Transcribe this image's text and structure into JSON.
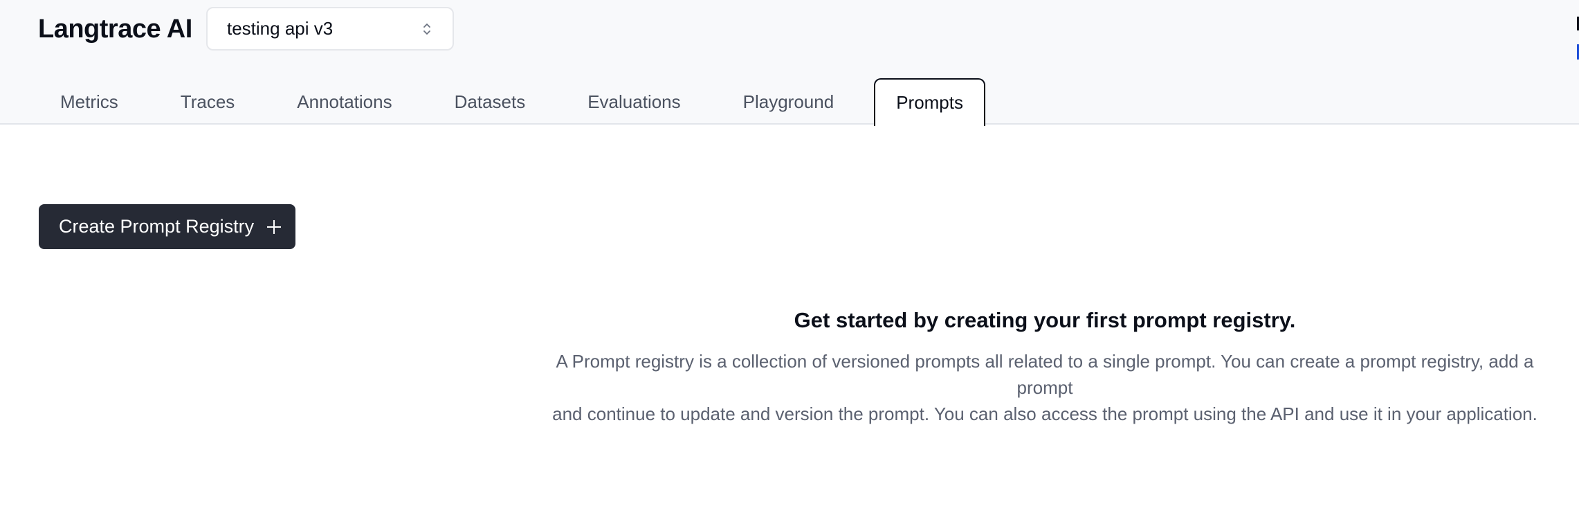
{
  "header": {
    "brand": "Langtrace AI",
    "project_select": {
      "value": "testing api v3",
      "icon": "chevron-up-down-icon"
    }
  },
  "tabs": [
    {
      "label": "Metrics",
      "active": false
    },
    {
      "label": "Traces",
      "active": false
    },
    {
      "label": "Annotations",
      "active": false
    },
    {
      "label": "Datasets",
      "active": false
    },
    {
      "label": "Evaluations",
      "active": false
    },
    {
      "label": "Playground",
      "active": false
    },
    {
      "label": "Prompts",
      "active": true
    }
  ],
  "main": {
    "create_button": {
      "label": "Create Prompt Registry",
      "icon": "plus-icon"
    },
    "empty_state": {
      "title": "Get started by creating your first prompt registry.",
      "line1": "A Prompt registry is a collection of versioned prompts all related to a single prompt. You can create a prompt registry, add a prompt",
      "line2": "and continue to update and version the prompt. You can also access the prompt using the API and use it in your application."
    }
  },
  "colors": {
    "header_bg": "#f8f9fb",
    "primary_button": "#262a35",
    "text_dark": "#0b0f19",
    "text_muted": "#5b6170",
    "link_blue": "#1d4ed8"
  }
}
